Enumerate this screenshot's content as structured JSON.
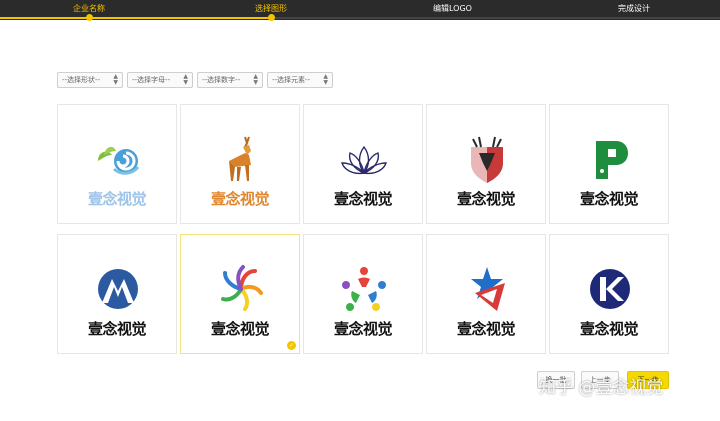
{
  "steps": [
    {
      "label": "企业名称",
      "active": true
    },
    {
      "label": "选择图形",
      "active": true
    },
    {
      "label": "编辑LOGO",
      "active": false
    },
    {
      "label": "完成设计",
      "active": false
    }
  ],
  "colors": {
    "accent": "#f5c400",
    "topbar": "#2b2b2b"
  },
  "filters": [
    {
      "value": "--选择形状--"
    },
    {
      "value": "--选择字母--"
    },
    {
      "value": "--选择数字--"
    },
    {
      "value": "--选择元素--"
    }
  ],
  "logos": [
    {
      "brand": "壹念视觉",
      "icon": "wave-leaf-icon",
      "color": "#9dc3e6"
    },
    {
      "brand": "壹念视觉",
      "icon": "deer-icon",
      "color": "#e0872e"
    },
    {
      "brand": "壹念视觉",
      "icon": "lotus-icon",
      "color": "#111111"
    },
    {
      "brand": "壹念视觉",
      "icon": "deer-shield-icon",
      "color": "#111111"
    },
    {
      "brand": "壹念视觉",
      "icon": "letter-p-icon",
      "color": "#111111"
    },
    {
      "brand": "壹念视觉",
      "icon": "mountain-circle-icon",
      "color": "#111111"
    },
    {
      "brand": "壹念视觉",
      "icon": "rainbow-swirl-icon",
      "color": "#111111",
      "selected": true
    },
    {
      "brand": "壹念视觉",
      "icon": "people-circle-icon",
      "color": "#111111"
    },
    {
      "brand": "壹念视觉",
      "icon": "star-flag-icon",
      "color": "#111111"
    },
    {
      "brand": "壹念视觉",
      "icon": "letter-k-icon",
      "color": "#111111"
    }
  ],
  "buttons": {
    "swap": "换一批",
    "prev": "上一步",
    "next": "下一步"
  },
  "watermark": "知乎 @壹念视觉"
}
